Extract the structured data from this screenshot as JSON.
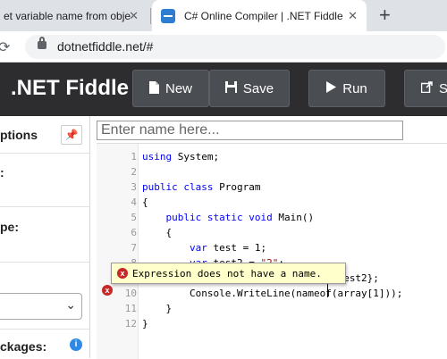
{
  "browser": {
    "inactive_tab_title": "et variable name from obje",
    "active_tab_title": "C# Online Compiler | .NET Fiddle",
    "close_glyph": "✕",
    "new_tab_glyph": "+",
    "url": "dotnetfiddle.net/#"
  },
  "header": {
    "logo": ".NET Fiddle",
    "new_label": "New",
    "save_label": "Save",
    "run_label": "Run",
    "share_label": "S"
  },
  "options": {
    "title": "ptions",
    "pin_glyph": "📌",
    "labels": [
      ":",
      "pe:",
      "ckages:"
    ],
    "select_chevron": "⌄",
    "info_glyph": "i"
  },
  "editor": {
    "name_placeholder": "Enter name here...",
    "line_numbers": [
      "1",
      "2",
      "3",
      "4",
      "5",
      "6",
      "7",
      "8",
      "9",
      "10",
      "11",
      "12"
    ],
    "lines": [
      "using System;",
      "",
      "public class Program",
      "{",
      "    public static void Main()",
      "    {",
      "        var test = 1;",
      "        var test2 = \"2\";",
      "        var array = new[] {test, test2};",
      "        Console.WriteLine(nameof(array[1]));",
      "    }",
      "}"
    ],
    "error_marker_line": "10",
    "error_glyph": "x",
    "tooltip_message": "Expression does not have a name."
  },
  "colors": {
    "keyword": "#0000ff",
    "string": "#a31515",
    "header_bg": "#2d2d30",
    "error": "#c62828",
    "tooltip_bg": "#ffffcc"
  }
}
